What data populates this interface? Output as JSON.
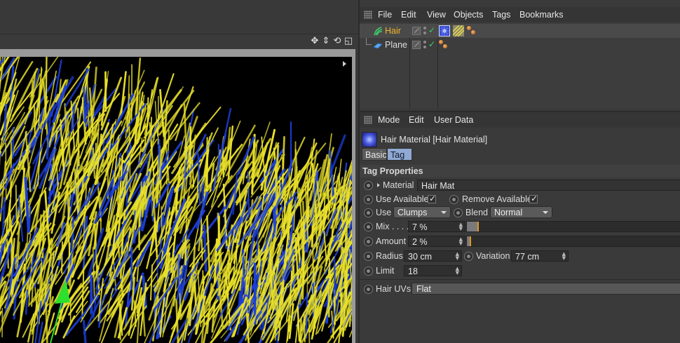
{
  "object_manager": {
    "menu": [
      "File",
      "Edit",
      "View",
      "Objects",
      "Tags",
      "Bookmarks"
    ],
    "objects": [
      {
        "name": "Hair",
        "selected": true,
        "name_color": "#f2b62a",
        "icon": "hair-object-icon",
        "tags": [
          "hair-material-tag-icon",
          "hair-tag-icon",
          "material-balls-icon"
        ]
      },
      {
        "name": "Plane",
        "selected": false,
        "name_color": "#dcdcdc",
        "icon": "plane-object-icon",
        "tags": [
          "material-balls-icon"
        ]
      }
    ]
  },
  "attribute_manager": {
    "menu": [
      "Mode",
      "Edit",
      "User Data"
    ],
    "title": "Hair Material [Hair Material]",
    "tabs": [
      {
        "label": "Basic",
        "active": false
      },
      {
        "label": "Tag",
        "active": true
      }
    ],
    "section": "Tag Properties",
    "material": {
      "label": "Material",
      "value": "Hair Mat"
    },
    "use_available": {
      "label": "Use Available",
      "checked": true
    },
    "remove_available": {
      "label": "Remove Available",
      "checked": true
    },
    "use": {
      "label": "Use",
      "value": "Clumps"
    },
    "blend": {
      "label": "Blend",
      "value": "Normal"
    },
    "mix": {
      "label": "Mix . . . .",
      "value": "7 %",
      "level": 0.07
    },
    "amount": {
      "label": "Amount",
      "value": "2 %",
      "level": 0.02
    },
    "radius": {
      "label": "Radius",
      "value": "30 cm"
    },
    "variation": {
      "label": "Variation",
      "value": "77 cm"
    },
    "limit": {
      "label": "Limit",
      "value": "18"
    },
    "hair_uvs": {
      "label": "Hair UVs",
      "value": "Flat"
    }
  },
  "colors": {
    "hair_yellow": "#e8e02a",
    "hair_blue": "#1c3fd8",
    "accent_orange": "#e2952a",
    "selected_tab": "#8fa9d2"
  }
}
